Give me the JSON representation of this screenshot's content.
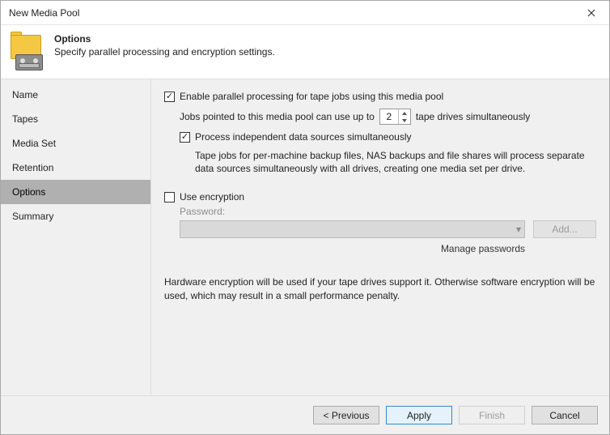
{
  "window": {
    "title": "New Media Pool"
  },
  "header": {
    "title": "Options",
    "description": "Specify parallel processing and encryption settings."
  },
  "sidebar": {
    "items": [
      {
        "label": "Name"
      },
      {
        "label": "Tapes"
      },
      {
        "label": "Media Set"
      },
      {
        "label": "Retention"
      },
      {
        "label": "Options"
      },
      {
        "label": "Summary"
      }
    ],
    "active_index": 4
  },
  "options": {
    "enable_parallel_label": "Enable parallel processing for tape jobs using this media pool",
    "enable_parallel_checked": true,
    "jobs_prefix": "Jobs pointed to this media pool can use up to",
    "drive_count": "2",
    "jobs_suffix": "tape drives simultaneously",
    "process_independent_label": "Process independent data sources simultaneously",
    "process_independent_checked": true,
    "process_independent_desc": "Tape jobs for per-machine backup files, NAS backups and file shares will process separate data sources simultaneously with all drives, creating one media set per drive.",
    "use_encryption_label": "Use encryption",
    "use_encryption_checked": false,
    "password_label": "Password:",
    "add_button": "Add...",
    "manage_passwords": "Manage passwords",
    "hw_note": "Hardware encryption will be used if your tape drives support it. Otherwise software encryption will be used, which may result in a small performance penalty."
  },
  "footer": {
    "previous": "< Previous",
    "apply": "Apply",
    "finish": "Finish",
    "cancel": "Cancel"
  }
}
